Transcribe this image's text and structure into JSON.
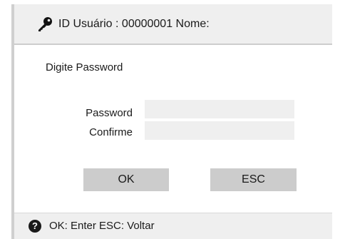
{
  "header": {
    "icon": "key-icon",
    "title": "ID Usuário : 00000001 Nome:"
  },
  "form": {
    "prompt": "Digite Password",
    "password_label": "Password",
    "password_value": "",
    "confirm_label": "Confirme",
    "confirm_value": ""
  },
  "buttons": {
    "ok_label": "OK",
    "esc_label": "ESC"
  },
  "footer": {
    "icon": "help-icon",
    "help_glyph": "?",
    "hint": "OK: Enter ESC: Voltar"
  },
  "colors": {
    "panel_bg": "#efefef",
    "button_bg": "#cccccc",
    "text": "#1a1a1a"
  }
}
